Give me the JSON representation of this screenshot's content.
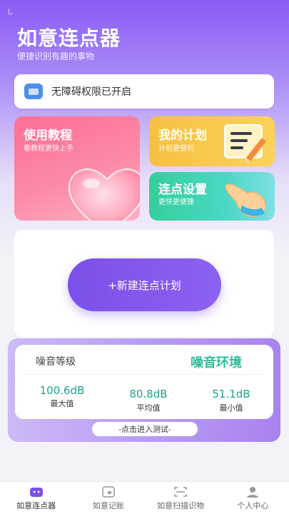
{
  "header": {
    "title": "如意连点器",
    "subtitle": "便捷识别有趣的事物"
  },
  "permission": {
    "text": "无障碍权限已开启",
    "icon": "accessibility-icon"
  },
  "cards": {
    "tutorial": {
      "title": "使用教程",
      "subtitle": "看教程更快上手",
      "icon": "heart-icon"
    },
    "plan": {
      "title": "我的计划",
      "subtitle": "计划更便利",
      "icon": "notepad-icon"
    },
    "settings": {
      "title": "连点设置",
      "subtitle": "更快更便捷",
      "icon": "hand-pointer-icon"
    }
  },
  "new_plan": {
    "label": "+新建连点计划"
  },
  "noise": {
    "level_label": "噪音等级",
    "environment_label": "噪音环境",
    "stats": [
      {
        "value": "100.6dB",
        "label": "最大值"
      },
      {
        "value": "80.8dB",
        "label": "平均值"
      },
      {
        "value": "51.1dB",
        "label": "最小值"
      }
    ],
    "test_button": "-点击进入测试-"
  },
  "tabbar": {
    "items": [
      {
        "label": "如意连点器",
        "icon": "robot-icon",
        "active": true
      },
      {
        "label": "如意记账",
        "icon": "ledger-icon",
        "active": false
      },
      {
        "label": "如意扫描识物",
        "icon": "scan-icon",
        "active": false
      },
      {
        "label": "个人中心",
        "icon": "user-icon",
        "active": false
      }
    ]
  },
  "colors": {
    "brand_purple": "#7b50ea",
    "tutorial_pink": "#fb6f95",
    "plan_yellow": "#f6c042",
    "settings_green": "#34cf9c",
    "noise_green": "#2fbd9a"
  }
}
